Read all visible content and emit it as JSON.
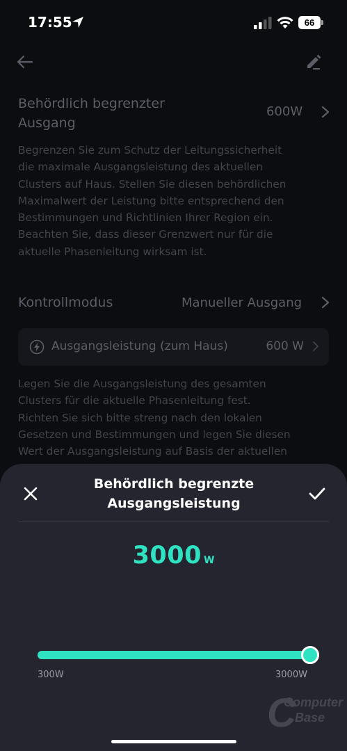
{
  "status_bar": {
    "time": "17:55",
    "battery_level": "66",
    "icons": [
      "location-arrow-icon",
      "cellular-signal-icon",
      "wifi-icon",
      "battery-icon"
    ]
  },
  "header": {
    "back_icon": "arrow-left-icon",
    "edit_icon": "pencil-icon"
  },
  "settings": {
    "limit_row": {
      "title_line1": "Behördlich begrenzter",
      "title_line2": "Ausgang",
      "value": "600W"
    },
    "limit_description": [
      "Begrenzen Sie zum Schutz der Leitungssicherheit",
      "die maximale Ausgangsleistung des aktuellen",
      "Clusters auf Haus. Stellen Sie diesen behördlichen",
      "Maximalwert der Leistung bitte entsprechend den",
      "Bestimmungen und Richtlinien Ihrer Region ein.",
      "Beachten Sie, dass dieser Grenzwert nur für die",
      "aktuelle Phasenleitung wirksam ist."
    ],
    "control_mode_row": {
      "title": "Kontrollmodus",
      "value": "Manueller Ausgang"
    },
    "output_power_card": {
      "icon": "lightning-bolt-icon",
      "label": "Ausgangsleistung (zum Haus)",
      "value": "600 W"
    },
    "output_description": [
      "Legen Sie die Ausgangsleistung des gesamten",
      "Clusters für die aktuelle Phasenleitung fest.",
      "Richten Sie sich bitte streng nach den lokalen",
      "Gesetzen und Bestimmungen und legen Sie diesen",
      "Wert der Ausgangsleistung auf Basis der aktuellen"
    ]
  },
  "sheet": {
    "title_line1": "Behördlich begrenzte",
    "title_line2": "Ausgangsleistung",
    "close_icon": "close-x-icon",
    "confirm_icon": "checkmark-icon",
    "value": "3000",
    "unit": "W",
    "slider": {
      "min": 300,
      "max": 3000,
      "current": 3000,
      "min_label": "300W",
      "max_label": "3000W"
    }
  },
  "watermark": {
    "line1": "Computer",
    "line2": "Base"
  },
  "colors": {
    "accent": "#2fe3c2",
    "background": "#0c0d11",
    "sheet": "#24252e"
  }
}
